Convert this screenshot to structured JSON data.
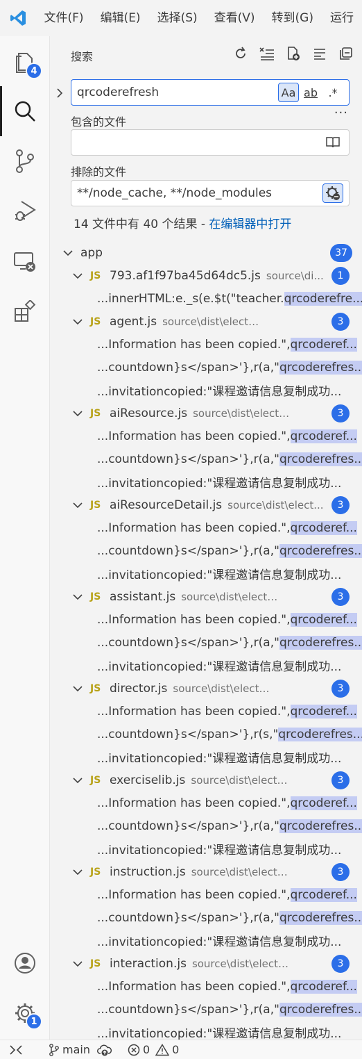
{
  "menu": [
    "文件(F)",
    "编辑(E)",
    "选择(S)",
    "查看(V)",
    "转到(G)",
    "运行"
  ],
  "activity": {
    "explorer_badge": "4",
    "settings_badge": "1"
  },
  "search": {
    "title": "搜索",
    "query": "qrcoderefresh",
    "opt_case": "Aa",
    "opt_word": "ab",
    "opt_regex": ".*",
    "more": "···",
    "include_label": "包含的文件",
    "include_value": "",
    "exclude_label": "排除的文件",
    "exclude_value": "**/node_cache, **/node_modules",
    "summary_text": "14 文件中有 40 个结果 - ",
    "summary_link": "在编辑器中打开"
  },
  "tree": {
    "folder": {
      "name": "app",
      "count": "37"
    },
    "files": [
      {
        "name": "793.af1f97ba45d64dc5.js",
        "path": "source\\di...",
        "count": "1",
        "matches": [
          {
            "pre": "...innerHTML:e._s(e.$t(\"teacher.",
            "hit": "qrcoderefre..."
          }
        ]
      },
      {
        "name": "agent.js",
        "path": "source\\dist\\electron",
        "count": "3",
        "matches": [
          {
            "pre": "...Information has been copied.\",",
            "hit": "qrcoderef..."
          },
          {
            "pre": "...countdown}s</span>'},r(a,\"",
            "hit": "qrcoderefres..."
          },
          {
            "pre": "...invitationcopied:\"课程邀请信息复制成功...",
            "hit": ""
          }
        ]
      },
      {
        "name": "aiResource.js",
        "path": "source\\dist\\electron",
        "count": "3",
        "matches": [
          {
            "pre": "...Information has been copied.\",",
            "hit": "qrcoderef..."
          },
          {
            "pre": "...countdown}s</span>'},r(a,\"",
            "hit": "qrcoderefres..."
          },
          {
            "pre": "...invitationcopied:\"课程邀请信息复制成功...",
            "hit": ""
          }
        ]
      },
      {
        "name": "aiResourceDetail.js",
        "path": "source\\dist\\elect...",
        "count": "3",
        "matches": [
          {
            "pre": "...Information has been copied.\",",
            "hit": "qrcoderef..."
          },
          {
            "pre": "...countdown}s</span>'},r(a,\"",
            "hit": "qrcoderefres..."
          },
          {
            "pre": "...invitationcopied:\"课程邀请信息复制成功...",
            "hit": ""
          }
        ]
      },
      {
        "name": "assistant.js",
        "path": "source\\dist\\electron",
        "count": "3",
        "matches": [
          {
            "pre": "...Information has been copied.\",",
            "hit": "qrcoderef..."
          },
          {
            "pre": "...countdown}s</span>'},r(a,\"",
            "hit": "qrcoderefres..."
          },
          {
            "pre": "...invitationcopied:\"课程邀请信息复制成功...",
            "hit": ""
          }
        ]
      },
      {
        "name": "director.js",
        "path": "source\\dist\\electron",
        "count": "3",
        "matches": [
          {
            "pre": "...Information has been copied.\",",
            "hit": "qrcoderef..."
          },
          {
            "pre": "...countdown}s</span>'},r(s,\"",
            "hit": "qrcoderefres..."
          },
          {
            "pre": "...invitationcopied:\"课程邀请信息复制成功...",
            "hit": ""
          }
        ]
      },
      {
        "name": "exerciselib.js",
        "path": "source\\dist\\electron",
        "count": "3",
        "matches": [
          {
            "pre": "...Information has been copied.\",",
            "hit": "qrcoderef..."
          },
          {
            "pre": "...countdown}s</span>'},r(a,\"",
            "hit": "qrcoderefres..."
          },
          {
            "pre": "...invitationcopied:\"课程邀请信息复制成功...",
            "hit": ""
          }
        ]
      },
      {
        "name": "instruction.js",
        "path": "source\\dist\\electron",
        "count": "3",
        "matches": [
          {
            "pre": "...Information has been copied.\",",
            "hit": "qrcoderef..."
          },
          {
            "pre": "...countdown}s</span>'},r(a,\"",
            "hit": "qrcoderefres..."
          },
          {
            "pre": "...invitationcopied:\"课程邀请信息复制成功...",
            "hit": ""
          }
        ]
      },
      {
        "name": "interaction.js",
        "path": "source\\dist\\electron",
        "count": "3",
        "matches": [
          {
            "pre": "...Information has been copied.\",",
            "hit": "qrcoderef..."
          },
          {
            "pre": "...countdown}s</span>'},r(a,\"",
            "hit": "qrcoderefres..."
          },
          {
            "pre": "...invitationcopied:\"课程邀请信息复制成功...",
            "hit": ""
          }
        ]
      }
    ]
  },
  "status": {
    "branch": "main",
    "errors": "0",
    "warnings": "0"
  },
  "icons": {
    "js": "JS",
    "names": [
      "vscode-logo-icon",
      "files-icon",
      "search-icon",
      "source-control-icon",
      "run-debug-icon",
      "remote-explorer-icon",
      "extensions-icon",
      "account-icon",
      "settings-gear-icon",
      "refresh-icon",
      "clear-results-icon",
      "new-search-editor-icon",
      "view-as-tree-icon",
      "collapse-all-icon",
      "book-icon",
      "exclude-settings-icon",
      "chevron-down-icon",
      "chevron-right-icon",
      "remote-icon",
      "branch-icon",
      "sync-icon",
      "error-icon",
      "warning-icon"
    ]
  },
  "colors": {
    "accent": "#2b6ee8",
    "link": "#005fb8",
    "highlight": "#c4ccf3",
    "js": "#b8a218"
  }
}
